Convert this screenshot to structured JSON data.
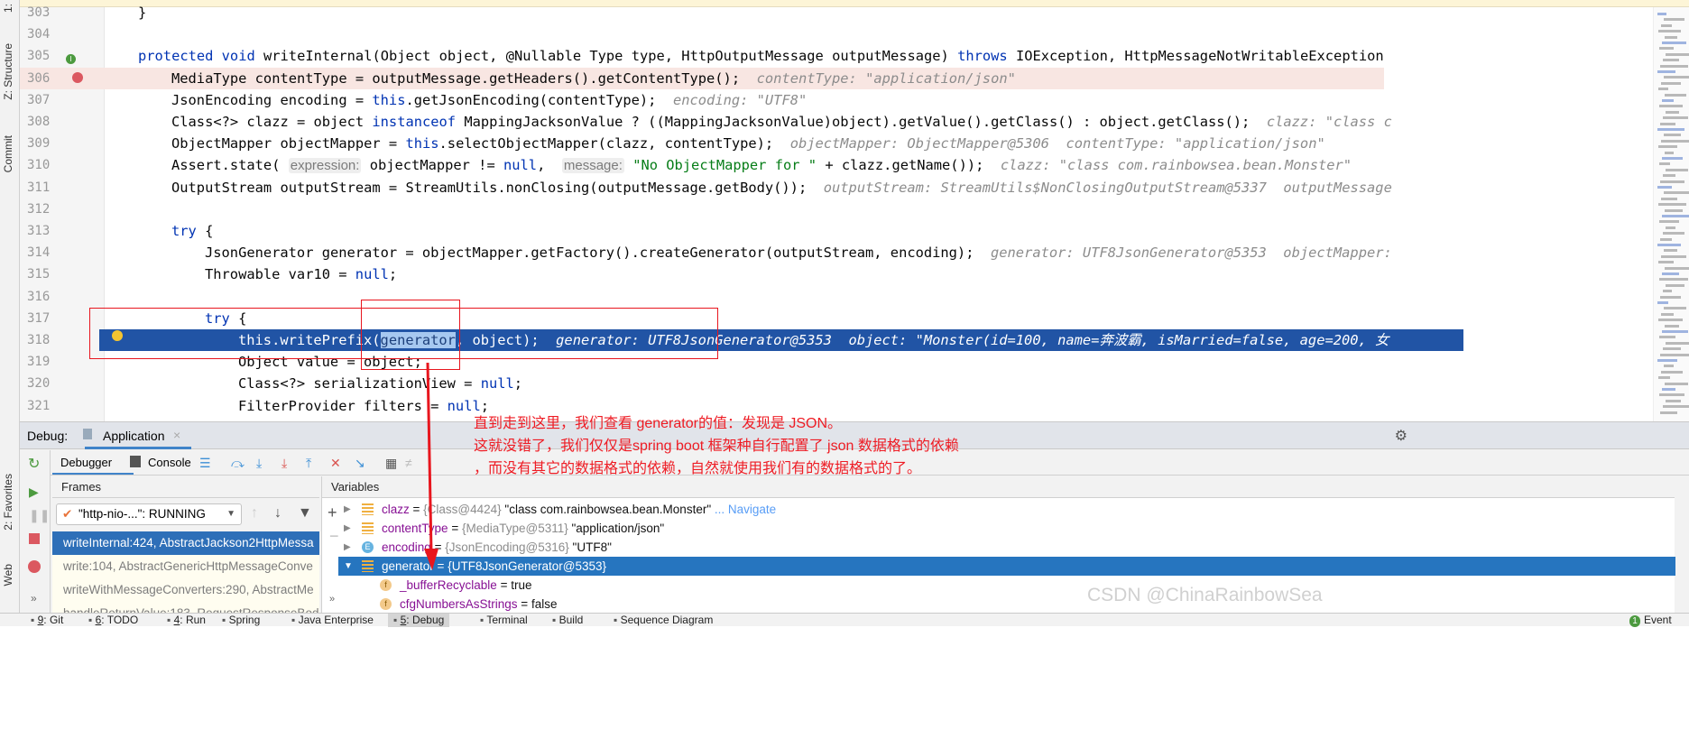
{
  "left_strip": {
    "tabs": [
      "1:",
      "Z: Structure",
      "Commit",
      "2: Favorites",
      "Web"
    ]
  },
  "editor": {
    "lines": [
      {
        "n": "303",
        "indent": 1,
        "tokens": [
          [
            "plain",
            "}"
          ]
        ]
      },
      {
        "n": "304",
        "indent": 0,
        "tokens": []
      },
      {
        "n": "305",
        "indent": 1,
        "tokens": [
          [
            "kw",
            "protected void "
          ],
          [
            "plain",
            "writeInternal(Object object, @Nullable Type type, HttpOutputMessage outputMessage) "
          ],
          [
            "kw",
            "throws "
          ],
          [
            "plain",
            "IOException, HttpMessageNotWritableException"
          ]
        ]
      },
      {
        "n": "306",
        "indent": 2,
        "tokens": [
          [
            "plain",
            "MediaType contentType = outputMessage.getHeaders().getContentType();  "
          ],
          [
            "hint",
            "contentType: \"application/json\""
          ]
        ]
      },
      {
        "n": "307",
        "indent": 2,
        "tokens": [
          [
            "plain",
            "JsonEncoding encoding = "
          ],
          [
            "kw",
            "this"
          ],
          [
            "plain",
            ".getJsonEncoding(contentType);  "
          ],
          [
            "hint",
            "encoding: \"UTF8\""
          ]
        ]
      },
      {
        "n": "308",
        "indent": 2,
        "tokens": [
          [
            "plain",
            "Class<?> clazz = object "
          ],
          [
            "kw",
            "instanceof "
          ],
          [
            "plain",
            "MappingJacksonValue ? ((MappingJacksonValue)object).getValue().getClass() : object.getClass();  "
          ],
          [
            "hint",
            "clazz: \"class c"
          ]
        ]
      },
      {
        "n": "309",
        "indent": 2,
        "tokens": [
          [
            "plain",
            "ObjectMapper objectMapper = "
          ],
          [
            "kw",
            "this"
          ],
          [
            "plain",
            ".selectObjectMapper(clazz, contentType);  "
          ],
          [
            "hint",
            "objectMapper: ObjectMapper@5306  contentType: \"application/json\""
          ]
        ]
      },
      {
        "n": "310",
        "indent": 2,
        "tokens": [
          [
            "plain",
            "Assert.state( "
          ],
          [
            "chip",
            "expression:"
          ],
          [
            "plain",
            " objectMapper != "
          ],
          [
            "kw",
            "null"
          ],
          [
            "plain",
            ",  "
          ],
          [
            "chip",
            "message:"
          ],
          [
            "str",
            " \"No ObjectMapper for \""
          ],
          [
            "plain",
            " + clazz.getName());  "
          ],
          [
            "hint",
            "clazz: \"class com.rainbowsea.bean.Monster\""
          ]
        ]
      },
      {
        "n": "311",
        "indent": 2,
        "tokens": [
          [
            "plain",
            "OutputStream outputStream = StreamUtils.nonClosing(outputMessage.getBody());  "
          ],
          [
            "hint",
            "outputStream: StreamUtils$NonClosingOutputStream@5337  outputMessage"
          ]
        ]
      },
      {
        "n": "312",
        "indent": 0,
        "tokens": []
      },
      {
        "n": "313",
        "indent": 2,
        "tokens": [
          [
            "kw",
            "try "
          ],
          [
            "plain",
            "{"
          ]
        ]
      },
      {
        "n": "314",
        "indent": 3,
        "tokens": [
          [
            "plain",
            "JsonGenerator generator = objectMapper.getFactory().createGenerator(outputStream, encoding);  "
          ],
          [
            "hint",
            "generator: UTF8JsonGenerator@5353  objectMapper:"
          ]
        ]
      },
      {
        "n": "315",
        "indent": 3,
        "tokens": [
          [
            "plain",
            "Throwable var10 = "
          ],
          [
            "kw",
            "null"
          ],
          [
            "plain",
            ";"
          ]
        ]
      },
      {
        "n": "316",
        "indent": 0,
        "tokens": []
      },
      {
        "n": "317",
        "indent": 3,
        "tokens": [
          [
            "kw",
            "try "
          ],
          [
            "plain",
            "{"
          ]
        ]
      },
      {
        "n": "318",
        "indent": 4,
        "tokens": [
          [
            "kw",
            "this"
          ],
          [
            "plain",
            ".writePrefix("
          ],
          [
            "sel",
            "generator"
          ],
          [
            "plain",
            ", object);  "
          ],
          [
            "hint",
            "generator: UTF8JsonGenerator@5353  object: \"Monster(id=100, name=奔波霸, isMarried=false, age=200, 女"
          ]
        ]
      },
      {
        "n": "319",
        "indent": 4,
        "tokens": [
          [
            "plain",
            "Object value = object;"
          ]
        ]
      },
      {
        "n": "320",
        "indent": 4,
        "tokens": [
          [
            "plain",
            "Class<?> serializationView = "
          ],
          [
            "kw",
            "null"
          ],
          [
            "plain",
            ";"
          ]
        ]
      },
      {
        "n": "321",
        "indent": 4,
        "tokens": [
          [
            "plain",
            "FilterProvider filters = "
          ],
          [
            "kw",
            "null"
          ],
          [
            "plain",
            ";"
          ]
        ]
      }
    ]
  },
  "annotation": {
    "lines": [
      "直到走到这里，我们查看 generator的值：发现是 JSON。",
      "这就没错了，我们仅仅是spring boot 框架种自行配置了 json 数据格式的依赖",
      "，而没有其它的数据格式的依赖，自然就使用我们有的数据格式的了。"
    ]
  },
  "debug": {
    "label": "Debug:",
    "tab": "Application",
    "debugger_tab": "Debugger",
    "console_tab": "Console",
    "frames_title": "Frames",
    "variables_title": "Variables",
    "thread": "\"http-nio-...\": RUNNING",
    "frames": [
      "writeInternal:424, AbstractJackson2HttpMessa",
      "write:104, AbstractGenericHttpMessageConve",
      "writeWithMessageConverters:290, AbstractMe",
      "handleReturnValue:183, RequestResponseBod"
    ],
    "variables": [
      {
        "name": "clazz",
        "type": "{Class@4424}",
        "value": "\"class com.rainbowsea.bean.Monster\"",
        "link": "... Navigate",
        "icon": "field-list",
        "expand": "▶"
      },
      {
        "name": "contentType",
        "type": "{MediaType@5311}",
        "value": "\"application/json\"",
        "icon": "field-list",
        "expand": "▶"
      },
      {
        "name": "encoding",
        "type": "{JsonEncoding@5316}",
        "value": "\"UTF8\"",
        "icon": "enum",
        "expand": "▶"
      },
      {
        "name": "generator",
        "type": "{UTF8JsonGenerator@5353}",
        "value": "",
        "icon": "field-list",
        "expand": "▼"
      },
      {
        "name": "_bufferRecyclable",
        "type": "",
        "value": "true",
        "icon": "f",
        "expand": ""
      },
      {
        "name": "cfgNumbersAsStrings",
        "type": "",
        "value": "false",
        "icon": "f",
        "expand": ""
      }
    ]
  },
  "bottom": {
    "items": [
      {
        "key": "9",
        "label": ": Git"
      },
      {
        "key": "6",
        "label": ": TODO"
      },
      {
        "key": "4",
        "label": ": Run"
      },
      {
        "key": "",
        "label": "Spring"
      },
      {
        "key": "",
        "label": "Java Enterprise"
      },
      {
        "key": "5",
        "label": ": Debug"
      },
      {
        "key": "",
        "label": "Terminal"
      },
      {
        "key": "",
        "label": "Build"
      },
      {
        "key": "",
        "label": "Sequence Diagram"
      }
    ],
    "event_count": "1",
    "event_label": "Event"
  },
  "watermark": "CSDN @ChinaRainbowSea",
  "colors": {
    "current_line": "#2154a5",
    "breakpoint_line": "#f8e6e2",
    "annotation": "#ee1c24",
    "selected_row": "#2675bf"
  }
}
